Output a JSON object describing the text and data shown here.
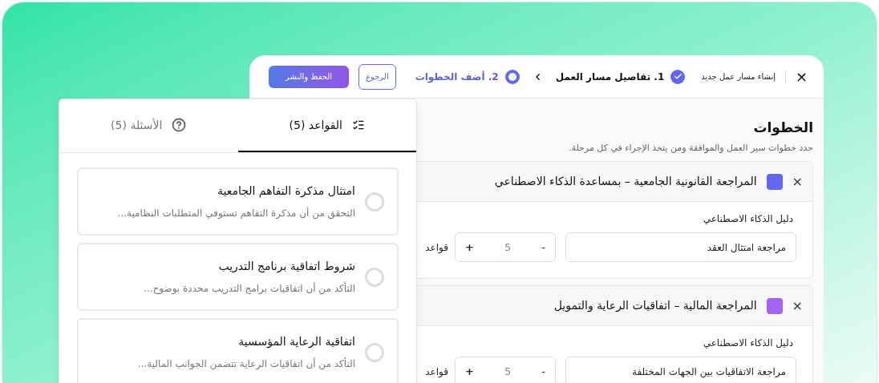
{
  "window": {
    "close": "×",
    "title": "إنشاء مسار عمل جديد",
    "steps": [
      {
        "label": "1. تفاصيل مسار العمل",
        "completed": true,
        "selected": false
      },
      {
        "label": "2. أضف الخطوات",
        "completed": false,
        "selected": true
      }
    ],
    "back_button": "الرجوع",
    "publish_button": "الحفظ والنشر"
  },
  "content": {
    "title": "الخطوات",
    "subtitle": "حدد خطوات سير العمل والموافقة ومن يتخذ الإجراء في كل مرحلة.",
    "workflow_steps": [
      {
        "remove": "×",
        "color": "#6366f1",
        "title": "المراجعة القانونية الجامعية – بمساعدة الذكاء الاصطناعي",
        "guide_label": "دليل الذكاء الاصطناعي",
        "guide_value": "مراجعة امتثال العقد",
        "minus": "-",
        "count": "5",
        "plus": "+",
        "count_label": "قواعد"
      },
      {
        "remove": "×",
        "color": "#a464f0",
        "title": "المراجعة المالية – اتفاقيات الرعاية والتمويل",
        "guide_label": "دليل الذكاء الاصطناعي",
        "guide_value": "مراجعة الاتفاقيات بين الجهات المختلفة",
        "minus": "-",
        "count": "5",
        "plus": "+",
        "count_label": "قواعد"
      }
    ]
  },
  "panel": {
    "tabs": [
      {
        "kind": "rules",
        "label": "القواعد (5)",
        "selected": true
      },
      {
        "kind": "questions",
        "label": "الأسئلة (5)",
        "selected": false
      }
    ],
    "rules": [
      {
        "title": "امتثال مذكرة التفاهم الجامعية",
        "description": "التحقق من أن مذكرة التفاهم تستوفي المتطلبات النظامية...",
        "selected": false
      },
      {
        "title": "شروط اتفاقية برنامج التدريب",
        "description": "التأكد من أن اتفاقيات برامج التدريب محددة بوضوح...",
        "selected": false
      },
      {
        "title": "اتفاقية الرعاية المؤسسية",
        "description": "التأكد من أن اتفاقيات الرعاية تتضمن الجوانب المالية...",
        "selected": false
      }
    ]
  }
}
